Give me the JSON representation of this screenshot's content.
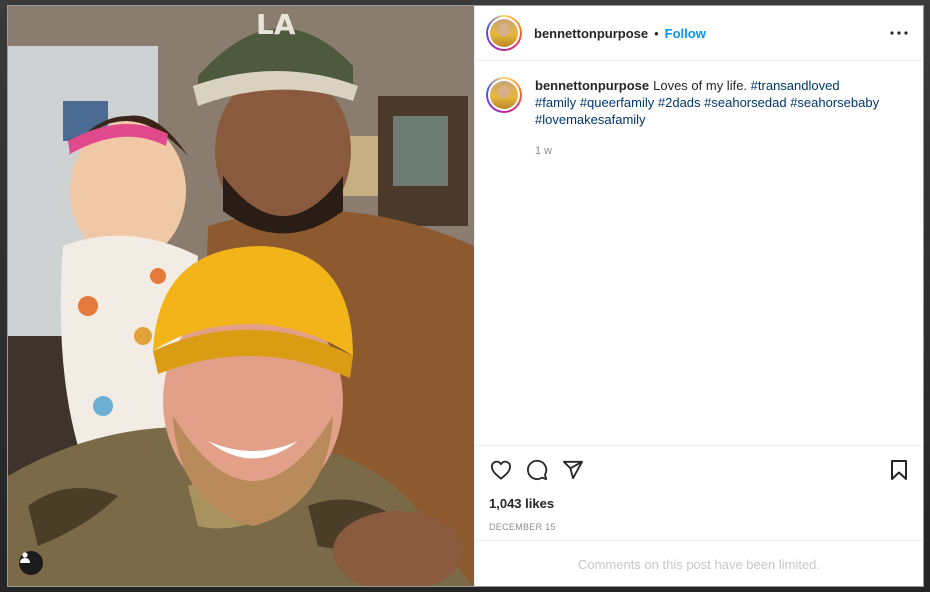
{
  "post": {
    "username": "bennettonpurpose",
    "separator": "•",
    "follow_label": "Follow",
    "more_icon": "more-options-icon"
  },
  "caption": {
    "username": "bennettonpurpose",
    "text": "Loves of my life.",
    "hashtags": [
      "#transandloved",
      "#family",
      "#queerfamily",
      "#2dads",
      "#seahorsedad",
      "#seahorsebaby",
      "#lovemakesafamily"
    ],
    "timestamp": "1 w"
  },
  "actions": {
    "icons": [
      "heart-icon",
      "comment-icon",
      "share-icon",
      "bookmark-icon"
    ]
  },
  "stats": {
    "likes": "1,043 likes",
    "date": "DECEMBER 15"
  },
  "footer": {
    "comments_notice": "Comments on this post have been limited."
  },
  "photo": {
    "user_tag_icon": "user-tag-icon"
  }
}
